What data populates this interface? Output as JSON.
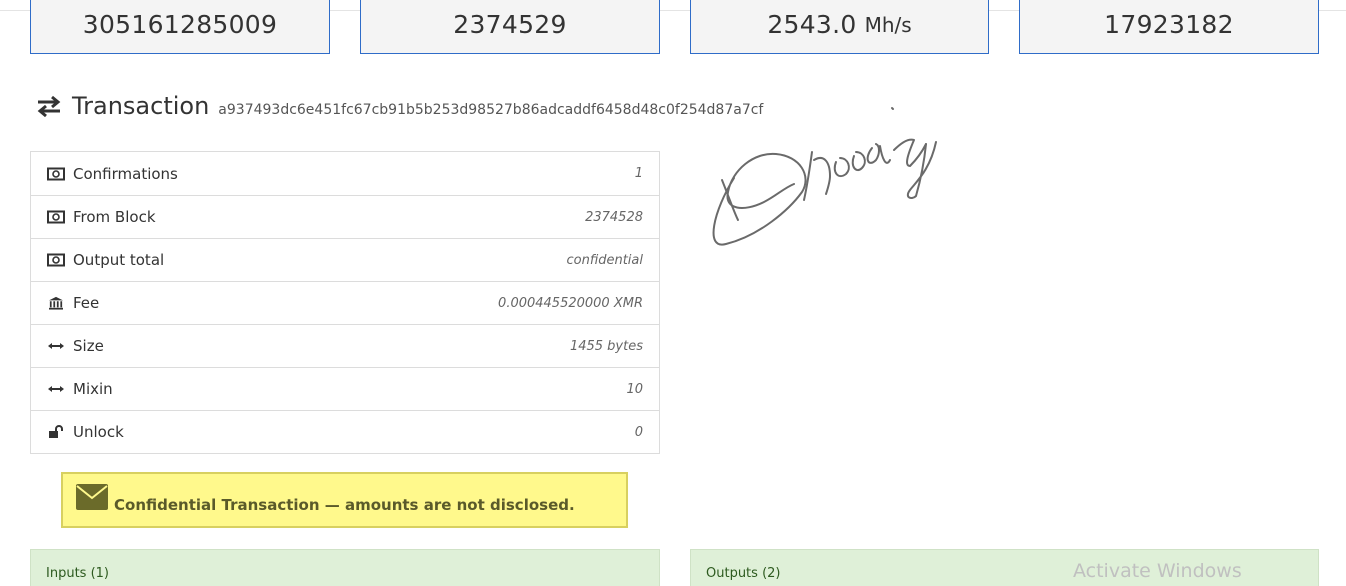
{
  "stats": [
    {
      "value": "305161285009",
      "unit": ""
    },
    {
      "value": "2374529",
      "unit": ""
    },
    {
      "value": "2543.0",
      "unit": "Mh/s"
    },
    {
      "value": "17923182",
      "unit": ""
    }
  ],
  "transaction": {
    "title": "Transaction",
    "hash": "a937493dc6e451fc67cb91b5b253d98527b86adcaddf6458d48c0f254d87a7cf",
    "icon": "exchange-arrows-icon"
  },
  "details": [
    {
      "icon": "money-icon",
      "label": "Confirmations",
      "value": "1"
    },
    {
      "icon": "money-icon",
      "label": "From Block",
      "value": "2374528"
    },
    {
      "icon": "money-icon",
      "label": "Output total",
      "value": "confidential"
    },
    {
      "icon": "bank-icon",
      "label": "Fee",
      "value": "0.000445520000 XMR"
    },
    {
      "icon": "horizontal-arrows-icon",
      "label": "Size",
      "value": "1455 bytes"
    },
    {
      "icon": "horizontal-arrows-icon",
      "label": "Mixin",
      "value": "10"
    },
    {
      "icon": "unlock-icon",
      "label": "Unlock",
      "value": "0"
    }
  ],
  "alert": {
    "icon": "envelope-icon",
    "text": "Confidential Transaction — amounts are not disclosed."
  },
  "inputs_panel": {
    "title": "Inputs (1)"
  },
  "outputs_panel": {
    "title": "Outputs (2)"
  },
  "watermark": {
    "text": "Activate Windows"
  },
  "colors": {
    "stat_border": "#2f6cc8",
    "alert_bg": "#fff98c",
    "panel_bg": "#dff0d8"
  }
}
